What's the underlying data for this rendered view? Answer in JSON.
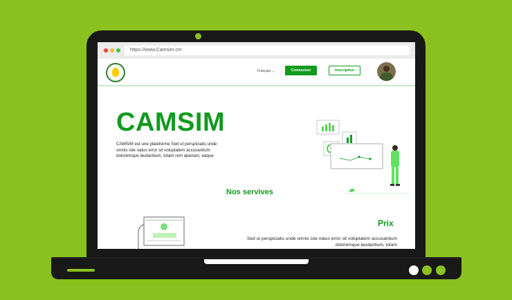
{
  "browser": {
    "url": "https://www.Camsim.cm",
    "window_dots": [
      "#f0413c",
      "#f9bb2d",
      "#3fc844"
    ]
  },
  "header": {
    "language": "Français",
    "connexion_label": "Connexion",
    "inscription_label": "Inscription"
  },
  "hero": {
    "title": "CAMSIM",
    "description": "CAMSIM est une plateforme Sed ut perspiciatis unde omnis iste natus error sit voluptatem accusantium doloremque laudantium, totam rem aperiam, eaque"
  },
  "sections": {
    "services_title": "Nos servives",
    "prix_title": "Prix",
    "prix_text": "Sed ut perspiciatis unde omnis iste natus error sit voluptatem accusantium doloremque laudantium, totam"
  },
  "colors": {
    "background": "#8ac11e",
    "brand_green": "#119b1e",
    "laptop": "#181818"
  },
  "laptop": {
    "base_dots": [
      "#ffffff",
      "#8ac11e",
      "#8ac11e"
    ]
  }
}
